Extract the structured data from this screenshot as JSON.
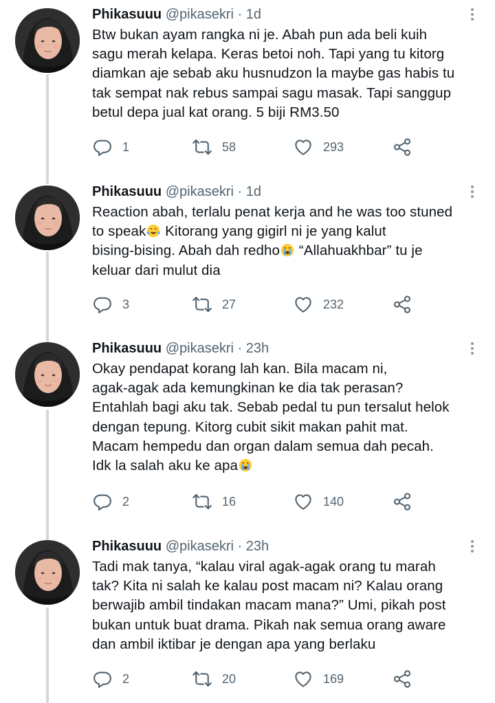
{
  "tweets": [
    {
      "name": "Phikasuuu",
      "handle": "@pikasekri",
      "separator": "·",
      "time": "1d",
      "lines": [
        "Btw bukan ayam rangka ni je. Abah pun ada beli kuih",
        "sagu merah kelapa. Keras betoi noh. Tapi yang tu kitorg",
        "diamkan aje sebab aku husnudzon la maybe gas habis tu",
        "tak sempat nak rebus sampai sagu masak. Tapi sanggup",
        "betul depa jual kat orang. 5 biji RM3.50"
      ],
      "replies": "1",
      "retweets": "58",
      "likes": "293"
    },
    {
      "name": "Phikasuuu",
      "handle": "@pikasekri",
      "separator": "·",
      "time": "1d",
      "lines": [
        "Reaction abah, terlalu penat kerja and he was too stuned",
        "to speak😂 Kitorang yang gigirl ni je yang kalut",
        "bising-bising. Abah dah redho😭 “Allahuakhbar” tu je",
        "keluar dari mulut dia"
      ],
      "replies": "3",
      "retweets": "27",
      "likes": "232"
    },
    {
      "name": "Phikasuuu",
      "handle": "@pikasekri",
      "separator": "·",
      "time": "23h",
      "lines": [
        "Okay pendapat korang lah kan. Bila macam ni,",
        "agak-agak ada kemungkinan ke dia tak perasan?",
        "Entahlah bagi aku tak. Sebab pedal tu pun tersalut helok",
        "dengan tepung. Kitorg cubit sikit makan pahit mat.",
        "Macam hempedu dan organ dalam semua dah pecah.",
        "Idk la salah aku ke apa😭"
      ],
      "replies": "2",
      "retweets": "16",
      "likes": "140"
    },
    {
      "name": "Phikasuuu",
      "handle": "@pikasekri",
      "separator": "·",
      "time": "23h",
      "lines": [
        "Tadi mak tanya, “kalau viral agak-agak orang tu marah",
        "tak? Kita ni salah ke kalau post macam ni? Kalau orang",
        "berwajib ambil tindakan macam mana?” Umi, pikah post",
        "bukan untuk buat drama. Pikah nak semua orang aware",
        "dan ambil iktibar je dengan apa yang berlaku"
      ],
      "replies": "2",
      "retweets": "20",
      "likes": "169"
    }
  ],
  "icons": {
    "reply": "reply-icon",
    "retweet": "retweet-icon",
    "like": "heart-icon",
    "share": "share-icon",
    "more": "more-vertical-icon"
  },
  "colors": {
    "icon": "#536471",
    "name": "#0f1419",
    "thread_line": "#cfd9de"
  }
}
